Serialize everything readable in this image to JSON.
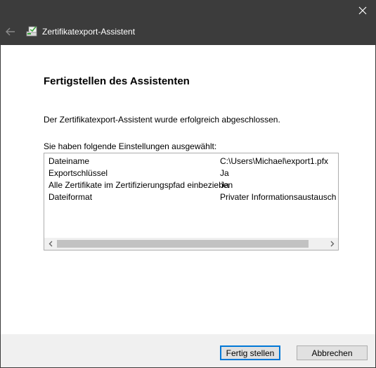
{
  "window": {
    "title": "Zertifikatexport-Assistent",
    "close_icon": "close-icon",
    "back_icon": "back-arrow-icon",
    "app_icon": "certificate-wizard-icon"
  },
  "page": {
    "heading": "Fertigstellen des Assistenten",
    "success_message": "Der Zertifikatexport-Assistent wurde erfolgreich abgeschlossen.",
    "settings_label": "Sie haben folgende Einstellungen ausgewählt:"
  },
  "settings": [
    {
      "name": "Dateiname",
      "value": "C:\\Users\\Michael\\export1.pfx"
    },
    {
      "name": "Exportschlüssel",
      "value": "Ja"
    },
    {
      "name": "Alle Zertifikate im Zertifizierungspfad einbeziehen",
      "value": "Ja"
    },
    {
      "name": "Dateiformat",
      "value": "Privater Informationsaustausch (*."
    }
  ],
  "buttons": {
    "finish": "Fertig stellen",
    "cancel": "Abbrechen"
  },
  "colors": {
    "titlebar": "#3c3c3c",
    "accent": "#0078d7"
  }
}
